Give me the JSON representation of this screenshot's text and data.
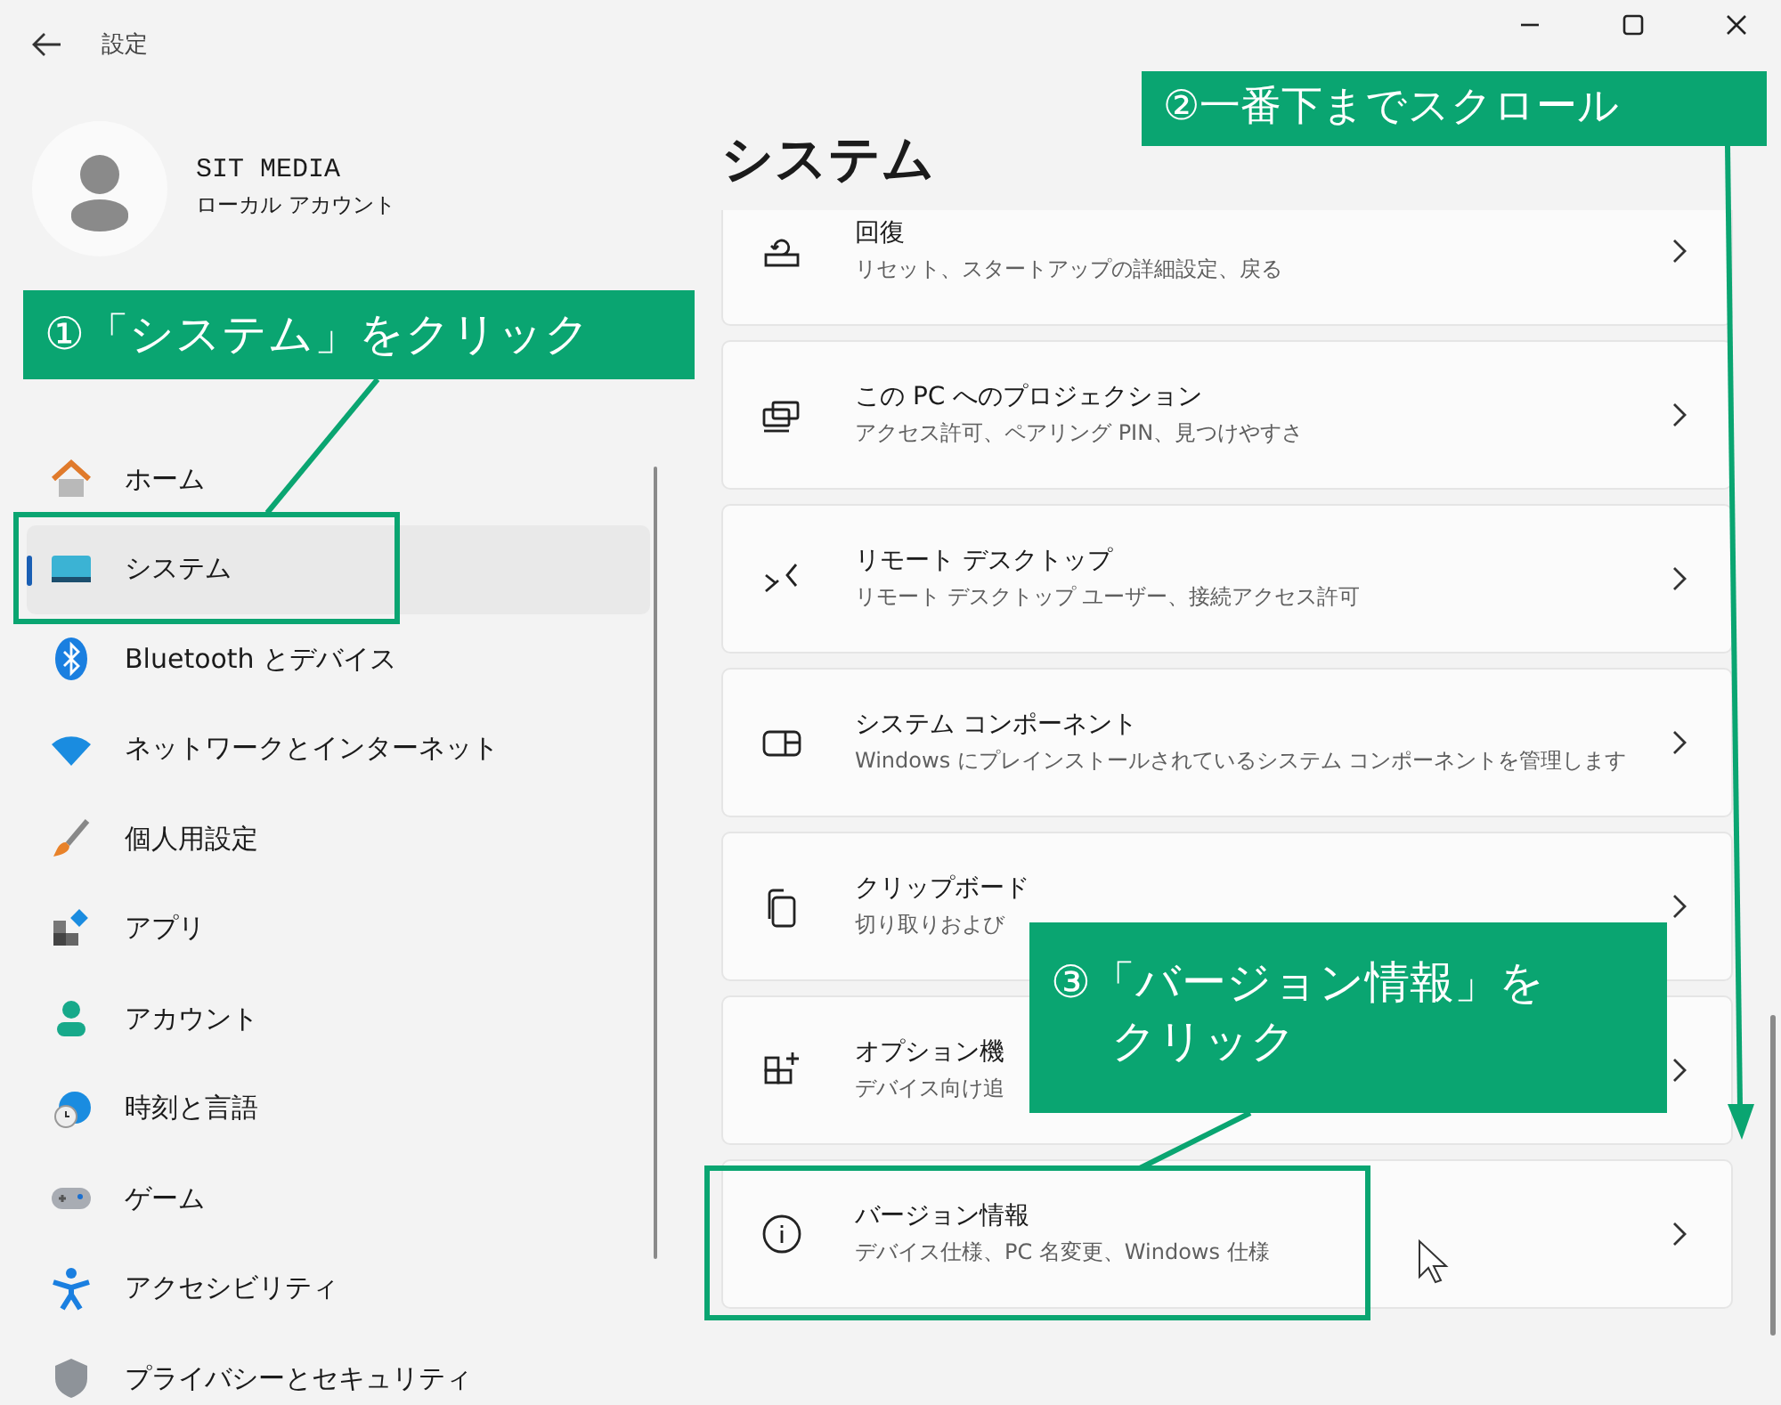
{
  "window": {
    "title": "設定"
  },
  "profile": {
    "name": "SIT MEDIA",
    "account_type": "ローカル アカウント"
  },
  "nav": [
    {
      "label": "ホーム",
      "selected": false
    },
    {
      "label": "システム",
      "selected": true
    },
    {
      "label": "Bluetooth とデバイス",
      "selected": false
    },
    {
      "label": "ネットワークとインターネット",
      "selected": false
    },
    {
      "label": "個人用設定",
      "selected": false
    },
    {
      "label": "アプリ",
      "selected": false
    },
    {
      "label": "アカウント",
      "selected": false
    },
    {
      "label": "時刻と言語",
      "selected": false
    },
    {
      "label": "ゲーム",
      "selected": false
    },
    {
      "label": "アクセシビリティ",
      "selected": false
    },
    {
      "label": "プライバシーとセキュリティ",
      "selected": false
    }
  ],
  "page_title": "システム",
  "cards": [
    {
      "title": "回復",
      "description": "リセット、スタートアップの詳細設定、戻る"
    },
    {
      "title": "この PC へのプロジェクション",
      "description": "アクセス許可、ペアリング PIN、見つけやすさ"
    },
    {
      "title": "リモート デスクトップ",
      "description": "リモート デスクトップ ユーザー、接続アクセス許可"
    },
    {
      "title": "システム コンポーネント",
      "description": "Windows にプレインストールされているシステム コンポーネントを管理します"
    },
    {
      "title": "クリップボード",
      "description": "切り取りおよび"
    },
    {
      "title": "オプション機",
      "description": "デバイス向け追"
    },
    {
      "title": "バージョン情報",
      "description": "デバイス仕様、PC 名変更、Windows 仕様"
    }
  ],
  "annotations": [
    {
      "kind": "callout",
      "text": "①「システム」をクリック"
    },
    {
      "kind": "callout",
      "text": "②一番下までスクロール"
    },
    {
      "kind": "callout",
      "lines": [
        "③「バージョン情報」を",
        "クリック"
      ]
    }
  ]
}
